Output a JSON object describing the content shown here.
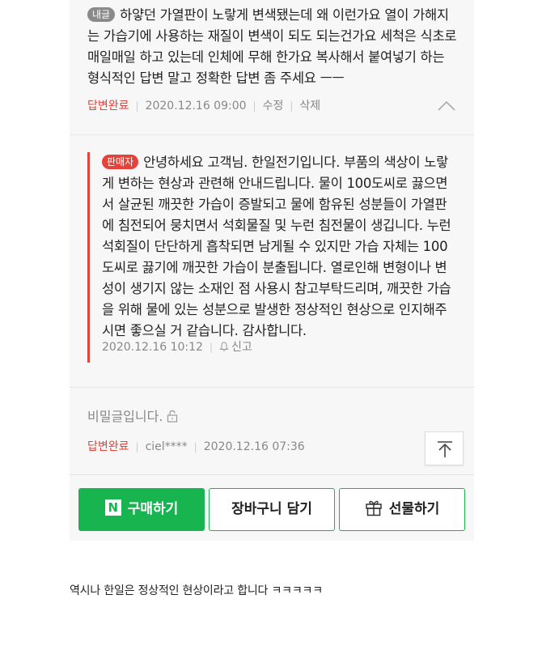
{
  "question": {
    "badge": "내글",
    "text": "하얗던 가열판이 노랗게 변색됐는데 왜 이런가요 열이 가해지는 가습기에 사용하는 재질이 변색이 되도 되는건가요 세척은 식초로 매일매일 하고 있는데 인체에 무해 한가요 복사해서 붙여넣기 하는 형식적인 답변 말고 정확한 답변 좀 주세요 ㅡㅡ",
    "status": "답변완료",
    "date": "2020.12.16 09:00",
    "edit": "수정",
    "delete": "삭제",
    "collapse_icon": "chevron-up-icon"
  },
  "answer": {
    "badge": "판매자",
    "text": "안녕하세요 고객님. 한일전기입니다. 부품의 색상이 노랗게 변하는 현상과 관련해 안내드립니다. 물이 100도씨로 끓으면서 살균된 깨끗한 가습이 증발되고 물에 함유된 성분들이 가열판에 침전되어 뭉치면서 석회물질 및 누런 침전물이 생깁니다. 누런 석회질이 단단하게 흡착되면 남게될 수 있지만 가습 자체는 100도씨로 끓기에 깨끗한 가습이 분출됩니다. 열로인해 변형이나 변성이 생기지 않는 소재인 점 사용시 참고부탁드리며, 깨끗한 가습을 위해 물에 있는 성분으로 발생한 정상적인 현상으로 인지해주시면 좋으실 거 같습니다. 감사합니다.",
    "date": "2020.12.16 10:12",
    "report": "신고",
    "report_icon": "bell-icon"
  },
  "secret_post": {
    "text": "비밀글입니다.",
    "lock_icon": "lock-icon",
    "status": "답변완료",
    "author": "ciel****",
    "date": "2020.12.16 07:36",
    "top_icon": "arrow-up-to-top-icon"
  },
  "actions": {
    "buy": "구매하기",
    "buy_logo": "N",
    "cart": "장바구니 담기",
    "gift": "선물하기",
    "gift_icon": "gift-icon"
  },
  "caption": "역시나 한일은 정상적인 현상이라고 합니다 ㅋㅋㅋㅋㅋ",
  "colors": {
    "accent_green": "#17b44f",
    "status_red": "#e5423a",
    "panel_bg": "#f7f7f7"
  }
}
